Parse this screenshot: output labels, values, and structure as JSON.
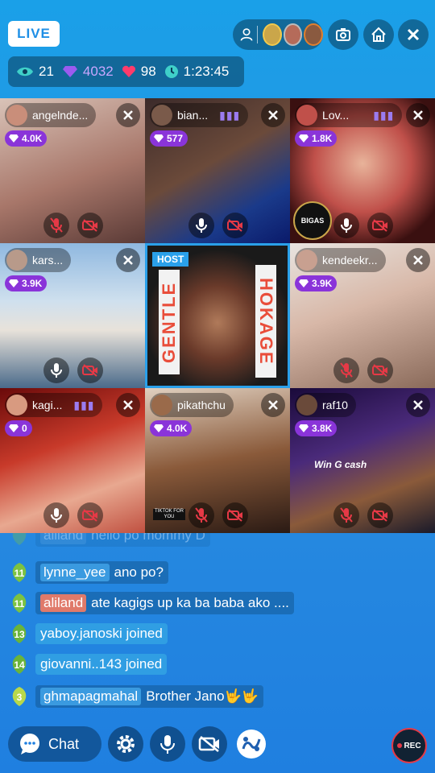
{
  "header": {
    "live_label": "LIVE",
    "stats": {
      "views": "21",
      "gems": "4032",
      "hearts": "98",
      "duration": "1:23:45"
    }
  },
  "tiles": [
    {
      "name": "angelnde...",
      "gems": "4.0K"
    },
    {
      "name": "bian...",
      "gems": "577"
    },
    {
      "name": "Lov...",
      "gems": "1.8K",
      "badge": "BIGAS"
    },
    {
      "name": "kars...",
      "gems": "3.9K"
    },
    {
      "host_label": "HOST",
      "left_text": "GENTLE",
      "right_text": "HOKAGE"
    },
    {
      "name": "kendeekr...",
      "gems": "3.9K"
    },
    {
      "name": "kagi...",
      "gems": "0"
    },
    {
      "name": "pikathchu",
      "gems": "4.0K",
      "shirt_text": "TIKTOK FOR YOU"
    },
    {
      "name": "raf10",
      "gems": "3.8K",
      "poster_text": "Win G cash"
    }
  ],
  "chat": [
    {
      "level": "",
      "user": "aliland",
      "text": "hello po mommy D"
    },
    {
      "level": "11",
      "user": "lynne_yee",
      "text": "ano po?"
    },
    {
      "level": "11",
      "user": "aliland",
      "text": "ate kagigs up ka ba baba ako ...."
    },
    {
      "level": "13",
      "user": "yaboy.janoski joined",
      "text": ""
    },
    {
      "level": "14",
      "user": "giovanni..143 joined",
      "text": ""
    },
    {
      "level": "3",
      "user": "ghmapagmahal",
      "text": "Brother Jano🤟🤟"
    }
  ],
  "footer": {
    "chat_label": "Chat",
    "rec_label": "REC"
  }
}
